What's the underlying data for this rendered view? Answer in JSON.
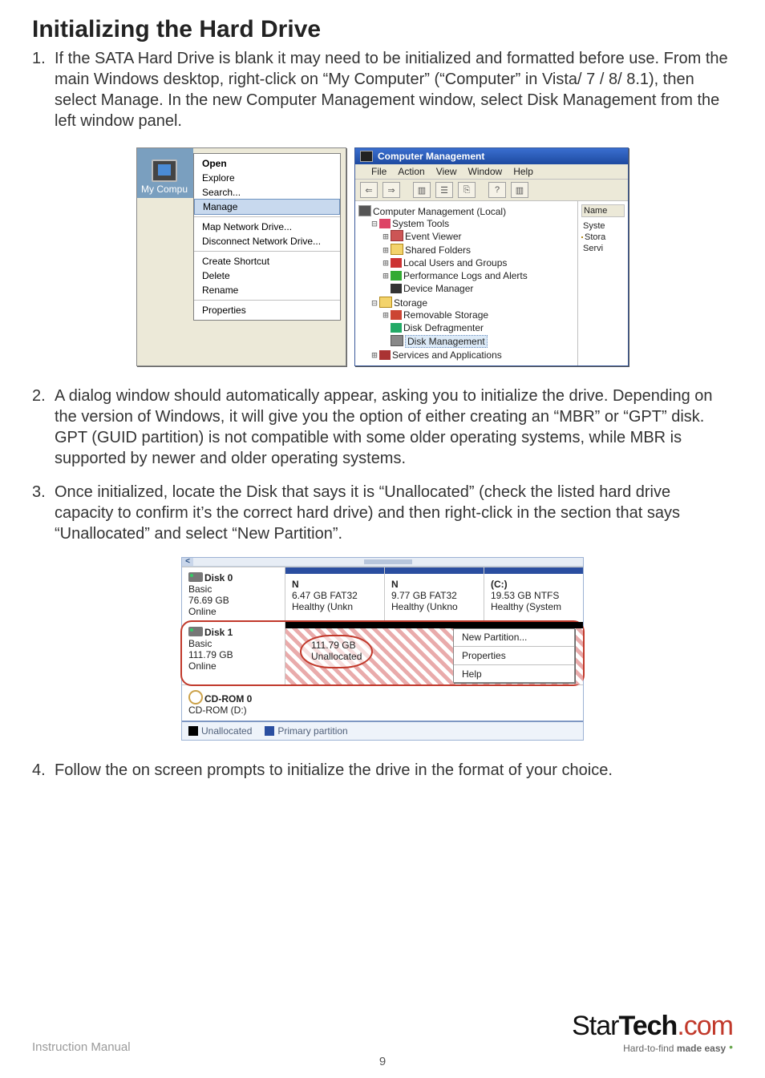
{
  "title": "Initializing the Hard Drive",
  "steps": {
    "s1": "If the SATA Hard Drive is blank it may need to be initialized and formatted before use. From the main Windows desktop, right-click on “My Computer” (“Computer” in Vista/ 7 / 8/ 8.1), then select Manage. In the new Computer Management window, select Disk Management from the left window panel.",
    "s2": "A dialog window should automatically appear, asking you to initialize the drive. Depending on the version of Windows, it will give you the option of either creating an “MBR” or “GPT” disk. GPT (GUID partition) is not compatible with some older operating systems, while MBR is supported by newer and older operating systems.",
    "s3": "Once initialized, locate the Disk that says it is “Unallocated” (check the listed hard drive capacity to confirm it’s the correct hard drive) and then right-click in the section that says “Unallocated” and select “New Partition”.",
    "s4": "Follow the on screen prompts to initialize the drive in the format of your choice."
  },
  "context_menu": {
    "icon_label": "My Compu",
    "g1": {
      "open": "Open",
      "explore": "Explore",
      "search": "Search...",
      "manage": "Manage"
    },
    "g2": {
      "map": "Map Network Drive...",
      "disc": "Disconnect Network Drive..."
    },
    "g3": {
      "shortcut": "Create Shortcut",
      "delete": "Delete",
      "rename": "Rename"
    },
    "g4": {
      "props": "Properties"
    }
  },
  "cm_window": {
    "title": "Computer Management",
    "menu": {
      "file": "File",
      "action": "Action",
      "view": "View",
      "window": "Window",
      "help": "Help"
    },
    "tree": {
      "root": "Computer Management (Local)",
      "systools": "System Tools",
      "event": "Event Viewer",
      "shared": "Shared Folders",
      "users": "Local Users and Groups",
      "perf": "Performance Logs and Alerts",
      "devmgr": "Device Manager",
      "storage": "Storage",
      "remov": "Removable Storage",
      "defrag": "Disk Defragmenter",
      "diskmgmt": "Disk Management",
      "services": "Services and Applications"
    },
    "right": {
      "col": "Name",
      "i1": "Syste",
      "i2": "Stora",
      "i3": "Servi"
    }
  },
  "diskmgmt": {
    "disk0": {
      "title": "Disk 0",
      "type": "Basic",
      "size": "76.69 GB",
      "status": "Online",
      "p1": {
        "lbl": "N",
        "l2": "6.47 GB FAT32",
        "l3": "Healthy (Unkn"
      },
      "p2": {
        "lbl": "N",
        "l2": "9.77 GB FAT32",
        "l3": "Healthy (Unkno"
      },
      "p3": {
        "lbl": "(C:)",
        "l2": "19.53 GB NTFS",
        "l3": "Healthy (System"
      }
    },
    "disk1": {
      "title": "Disk 1",
      "type": "Basic",
      "size": "111.79 GB",
      "status": "Online",
      "un_size": "111.79 GB",
      "un_label": "Unallocated"
    },
    "cdrom": {
      "title": "CD-ROM 0",
      "sub": "CD-ROM (D:)"
    },
    "ctx": {
      "newp": "New Partition...",
      "props": "Properties",
      "help": "Help"
    },
    "legend": {
      "un": "Unallocated",
      "pp": "Primary partition"
    }
  },
  "footer": {
    "manual": "Instruction Manual",
    "page": "9",
    "brand1": "Star",
    "brand2": "Tech",
    "brand3": ".com",
    "tag1": "Hard-to-find ",
    "tag2": "made easy"
  }
}
